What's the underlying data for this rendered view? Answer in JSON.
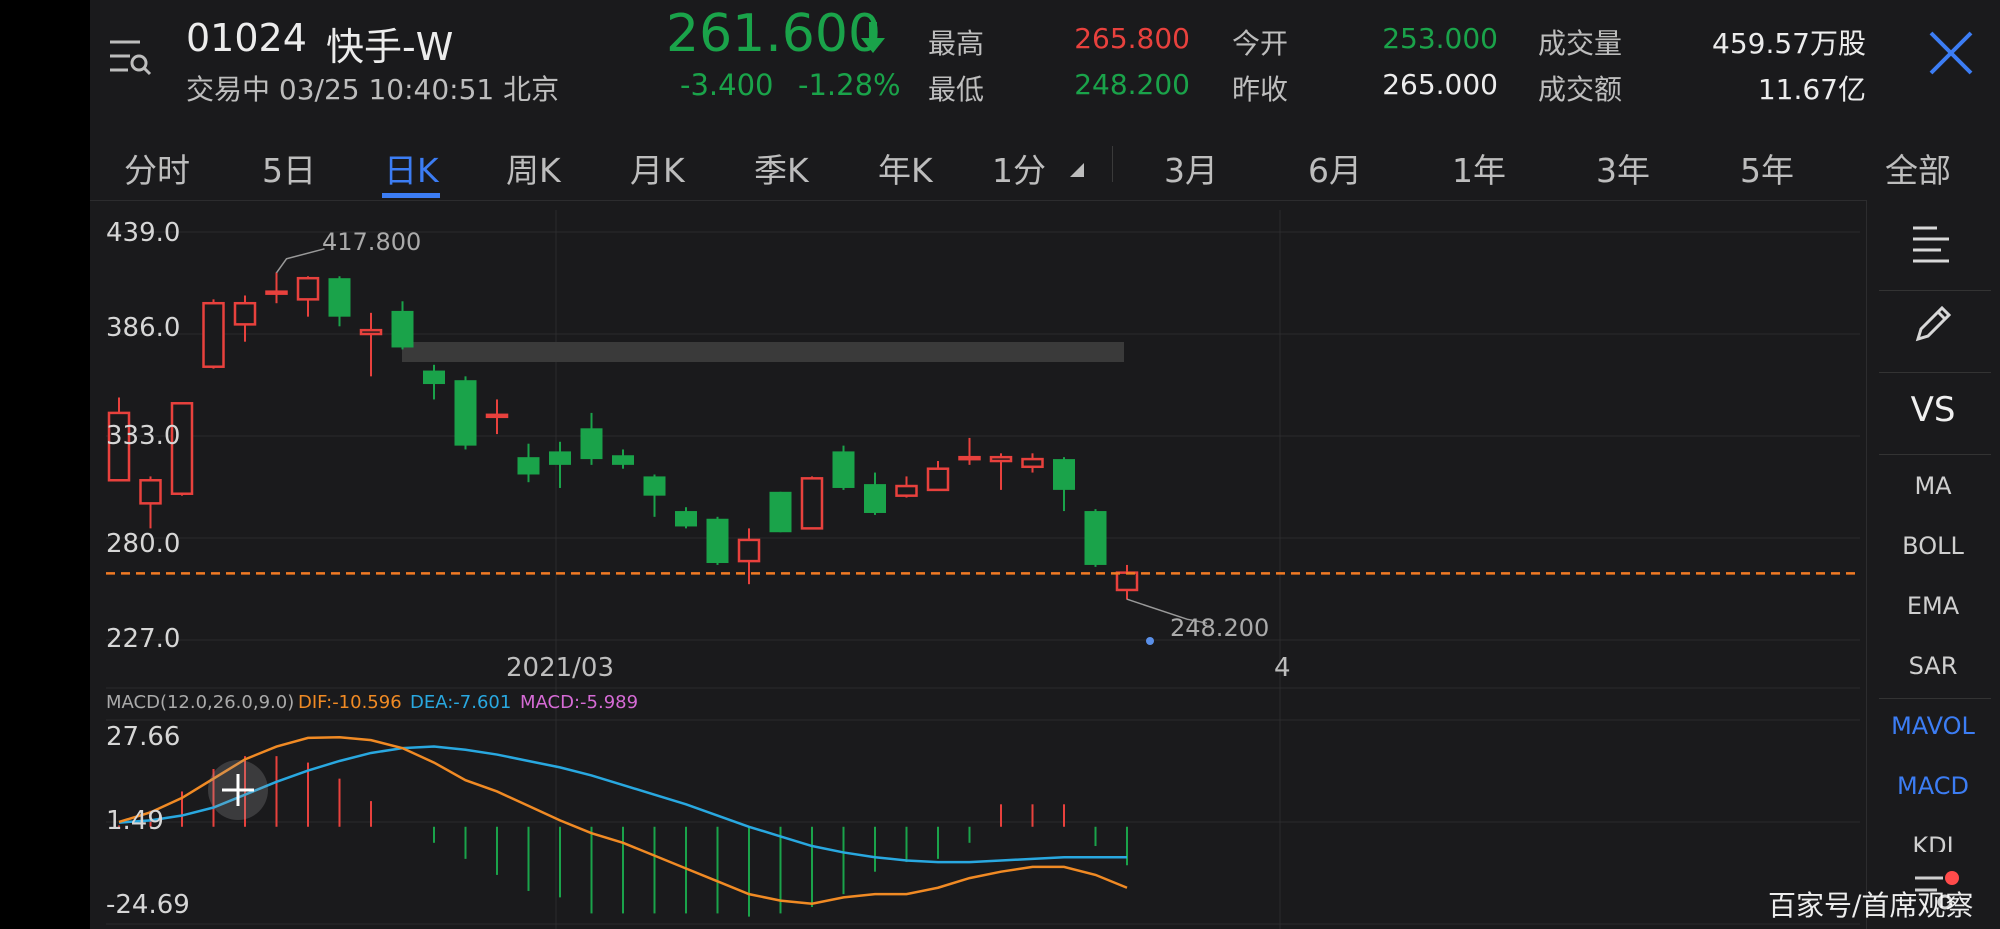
{
  "header": {
    "code": "01024",
    "name": "快手-W",
    "status": "交易中 03/25 10:40:51 北京",
    "price": "261.600",
    "change": "-3.400",
    "change_pct": "-1.28%",
    "high_label": "最高",
    "high_value": "265.800",
    "low_label": "最低",
    "low_value": "248.200",
    "open_label": "今开",
    "open_value": "253.000",
    "prev_label": "昨收",
    "prev_value": "265.000",
    "volume_label": "成交量",
    "volume_value": "459.57万股",
    "amount_label": "成交额",
    "amount_value": "11.67亿"
  },
  "tabs": {
    "t1": "分时",
    "t2": "5日",
    "t3": "日K",
    "t4": "周K",
    "t5": "月K",
    "t6": "季K",
    "t7": "年K",
    "t8": "1分",
    "t9": "3月",
    "t10": "6月",
    "t11": "1年",
    "t12": "3年",
    "t13": "5年",
    "t14": "全部"
  },
  "sidebar": {
    "vs": "VS",
    "ma": "MA",
    "boll": "BOLL",
    "ema": "EMA",
    "sar": "SAR",
    "mavol": "MAVOL",
    "macd": "MACD",
    "kdj": "KDJ"
  },
  "chart_labels": {
    "y1": "439.0",
    "y2": "386.0",
    "y3": "333.0",
    "y4": "280.0",
    "y5": "227.0",
    "date1": "2021/03",
    "date2": "4",
    "max_label": "417.800",
    "min_label": "248.200",
    "macd_title": "MACD(12.0,26.0,9.0)",
    "dif": "DIF:-10.596",
    "dea": "DEA:-7.601",
    "macd": "MACD:-5.989",
    "m1": "27.66",
    "m2": "1.49",
    "m3": "-24.69"
  },
  "watermark": "百家号/首席观察",
  "colors": {
    "up": "#e8413d",
    "down": "#1aa34a",
    "accent": "#3c7df4",
    "dif": "#f08a24",
    "dea": "#29a8e0",
    "macd": "#d66bd6"
  },
  "chart_data": [
    {
      "type": "candlestick",
      "title": "日K",
      "y_ticks": [
        439.0,
        386.0,
        333.0,
        280.0,
        227.0
      ],
      "ylim": [
        227.0,
        439.0
      ],
      "x_labels": [
        "2021/03",
        "4"
      ],
      "current_price_line": 261.6,
      "annotations": [
        {
          "text": "417.800",
          "value": 417.8
        },
        {
          "text": "248.200",
          "value": 248.2
        }
      ],
      "candles": [
        {
          "o": 310,
          "c": 345,
          "h": 353,
          "l": 310
        },
        {
          "o": 298,
          "c": 310,
          "h": 312,
          "l": 285
        },
        {
          "o": 303,
          "c": 350,
          "h": 350,
          "l": 302
        },
        {
          "o": 369,
          "c": 402,
          "h": 404,
          "l": 368
        },
        {
          "o": 391,
          "c": 402,
          "h": 406,
          "l": 382
        },
        {
          "o": 407,
          "c": 408,
          "h": 418,
          "l": 402
        },
        {
          "o": 404,
          "c": 415,
          "h": 416,
          "l": 395
        },
        {
          "o": 415,
          "c": 395,
          "h": 416,
          "l": 390
        },
        {
          "o": 386,
          "c": 388,
          "h": 397,
          "l": 364
        },
        {
          "o": 398,
          "c": 379,
          "h": 403,
          "l": 378
        },
        {
          "o": 367,
          "c": 360,
          "h": 370,
          "l": 352
        },
        {
          "o": 362,
          "c": 328,
          "h": 364,
          "l": 326
        },
        {
          "o": 344,
          "c": 344,
          "h": 352,
          "l": 334
        },
        {
          "o": 322,
          "c": 313,
          "h": 329,
          "l": 309
        },
        {
          "o": 325,
          "c": 318,
          "h": 330,
          "l": 306
        },
        {
          "o": 337,
          "c": 321,
          "h": 345,
          "l": 318
        },
        {
          "o": 323,
          "c": 318,
          "h": 326,
          "l": 316
        },
        {
          "o": 312,
          "c": 302,
          "h": 313,
          "l": 291
        },
        {
          "o": 294,
          "c": 286,
          "h": 296,
          "l": 285
        },
        {
          "o": 290,
          "c": 267,
          "h": 291,
          "l": 266
        },
        {
          "o": 268,
          "c": 279,
          "h": 285,
          "l": 256
        },
        {
          "o": 304,
          "c": 283,
          "h": 304,
          "l": 283
        },
        {
          "o": 285,
          "c": 311,
          "h": 312,
          "l": 285
        },
        {
          "o": 325,
          "c": 306,
          "h": 328,
          "l": 305
        },
        {
          "o": 308,
          "c": 293,
          "h": 314,
          "l": 292
        },
        {
          "o": 302,
          "c": 307,
          "h": 312,
          "l": 301
        },
        {
          "o": 305,
          "c": 316,
          "h": 320,
          "l": 305
        },
        {
          "o": 322,
          "c": 322,
          "h": 332,
          "l": 318
        },
        {
          "o": 320,
          "c": 322,
          "h": 324,
          "l": 305
        },
        {
          "o": 317,
          "c": 321,
          "h": 324,
          "l": 314
        },
        {
          "o": 321,
          "c": 305,
          "h": 322,
          "l": 294
        },
        {
          "o": 294,
          "c": 266,
          "h": 295,
          "l": 265
        },
        {
          "o": 253,
          "c": 262,
          "h": 266,
          "l": 248
        }
      ]
    },
    {
      "type": "line+bar",
      "title": "MACD(12.0,26.0,9.0)",
      "y_ticks": [
        27.66,
        1.49,
        -24.69
      ],
      "series": [
        {
          "name": "DIF",
          "values": [
            1.5,
            4.5,
            9,
            15,
            21,
            25,
            27.7,
            27.9,
            27,
            24.5,
            20,
            14.5,
            11,
            6.5,
            2,
            -2,
            -5,
            -9,
            -13,
            -17,
            -21,
            -23,
            -24,
            -22,
            -21,
            -21,
            -19,
            -16,
            -14,
            -12.5,
            -12.5,
            -15,
            -19
          ]
        },
        {
          "name": "DEA",
          "values": [
            1.3,
            2,
            3.5,
            6,
            10,
            14,
            17.5,
            20.5,
            23,
            24.5,
            25,
            24,
            22.5,
            20.5,
            18.5,
            16,
            13,
            10,
            7,
            3.5,
            0,
            -3,
            -6,
            -8,
            -9.5,
            -10.5,
            -11,
            -11,
            -10.5,
            -10,
            -9.5,
            -9.5,
            -9.5
          ]
        },
        {
          "name": "MACD",
          "values": [
            0.4,
            5,
            11,
            18,
            22,
            22,
            20,
            15,
            8,
            0,
            -5,
            -10,
            -15,
            -20,
            -22,
            -27,
            -27,
            -27,
            -27,
            -27,
            -28,
            -27,
            -25,
            -21,
            -14,
            -11,
            -10,
            -5,
            7,
            7,
            7,
            -6,
            -12
          ]
        }
      ]
    }
  ]
}
